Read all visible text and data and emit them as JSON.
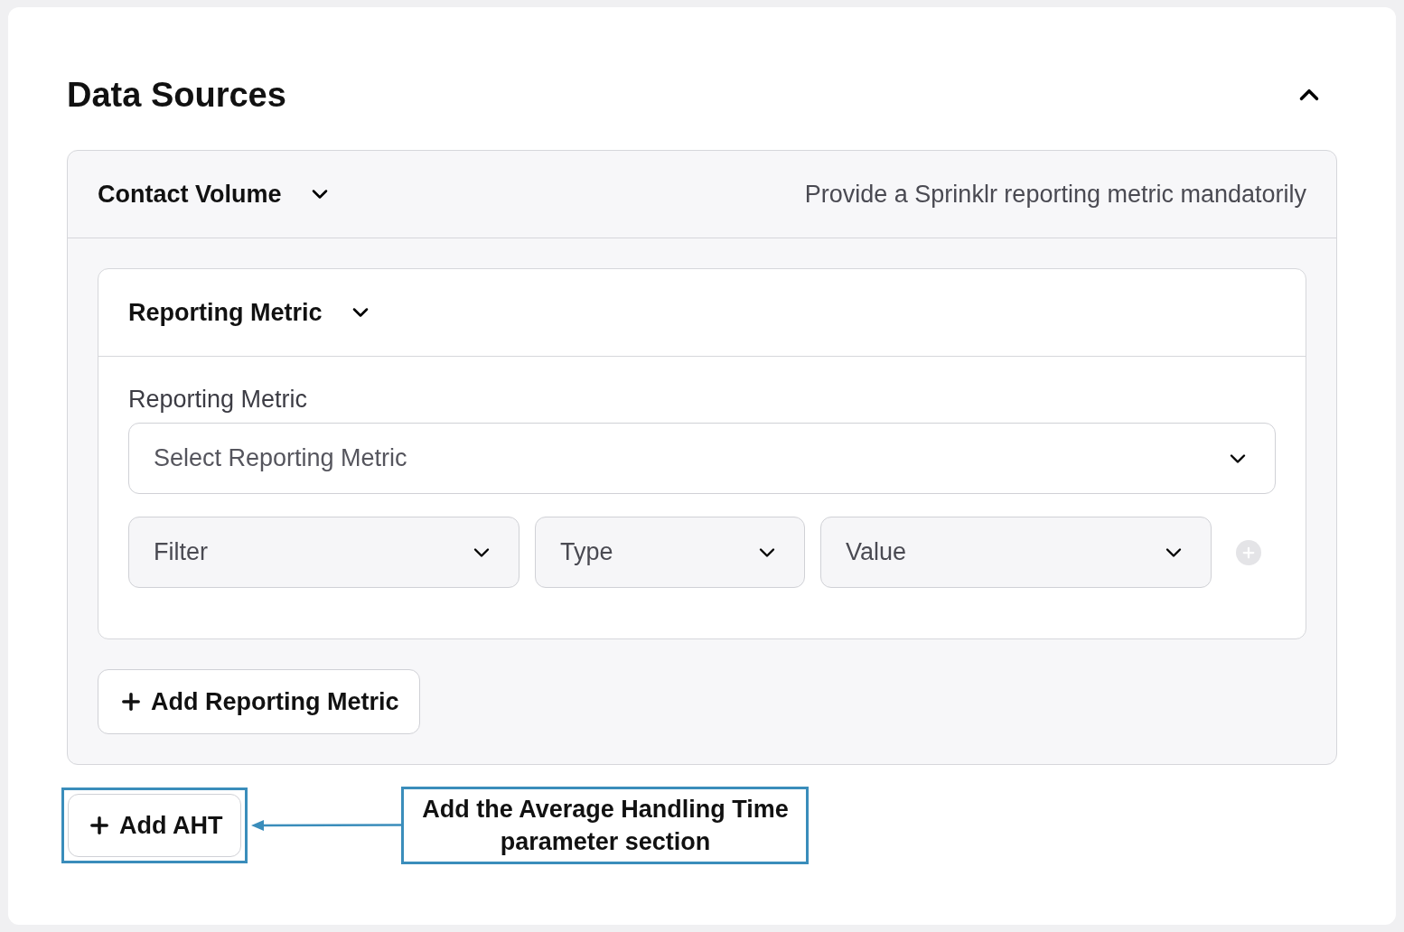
{
  "section": {
    "title": "Data Sources",
    "expanded": true
  },
  "source": {
    "name": "Contact Volume",
    "hint": "Provide a Sprinklr reporting metric mandatorily"
  },
  "metric_card": {
    "title": "Reporting Metric",
    "field_label": "Reporting Metric",
    "select": {
      "placeholder": "Select Reporting Metric"
    },
    "filters": [
      {
        "placeholder": "Filter"
      },
      {
        "placeholder": "Type"
      },
      {
        "placeholder": "Value"
      }
    ]
  },
  "add_metric_button": "Add Reporting Metric",
  "add_aht_button": "Add AHT",
  "annotation": "Add the Average Handling Time parameter section"
}
